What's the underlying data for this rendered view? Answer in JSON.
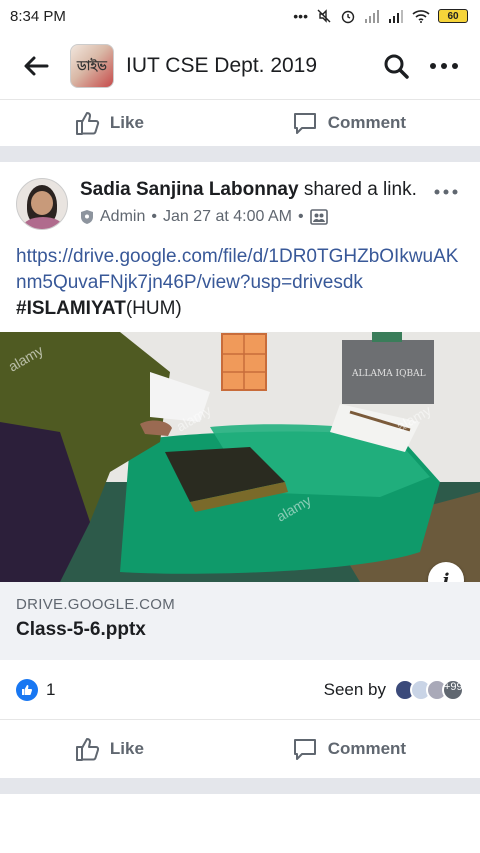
{
  "status_bar": {
    "time": "8:34 PM",
    "battery": "60"
  },
  "app_bar": {
    "title": "IUT CSE Dept. 2019",
    "thumb_text": "ডাইভ"
  },
  "top_actions": {
    "like": "Like",
    "comment": "Comment"
  },
  "post": {
    "author": "Sadia Sanjina Labonnay",
    "action": " shared a link.",
    "role": "Admin",
    "dot1": "•",
    "date": "Jan 27 at 4:00 AM",
    "dot2": "•",
    "link_text": "https://drive.google.com/file/d/1DR0TGHZbOIkwuAKnm5QuvaFNjk7jn46P/view?usp=drivesdk",
    "hashtag": "#ISLAMIYAT",
    "suffix": "(HUM)",
    "plaque_text": "ALLAMA IQBAL",
    "watermark": "alamy",
    "link_card": {
      "domain": "DRIVE.GOOGLE.COM",
      "title": "Class-5-6.pptx"
    },
    "like_count": "1",
    "seen_label": "Seen by",
    "seen_extra": "+99"
  },
  "bottom_actions": {
    "like": "Like",
    "comment": "Comment"
  },
  "colors": {
    "link": "#385898",
    "like_blue": "#1877f2",
    "separator": "#e4e6eb"
  }
}
